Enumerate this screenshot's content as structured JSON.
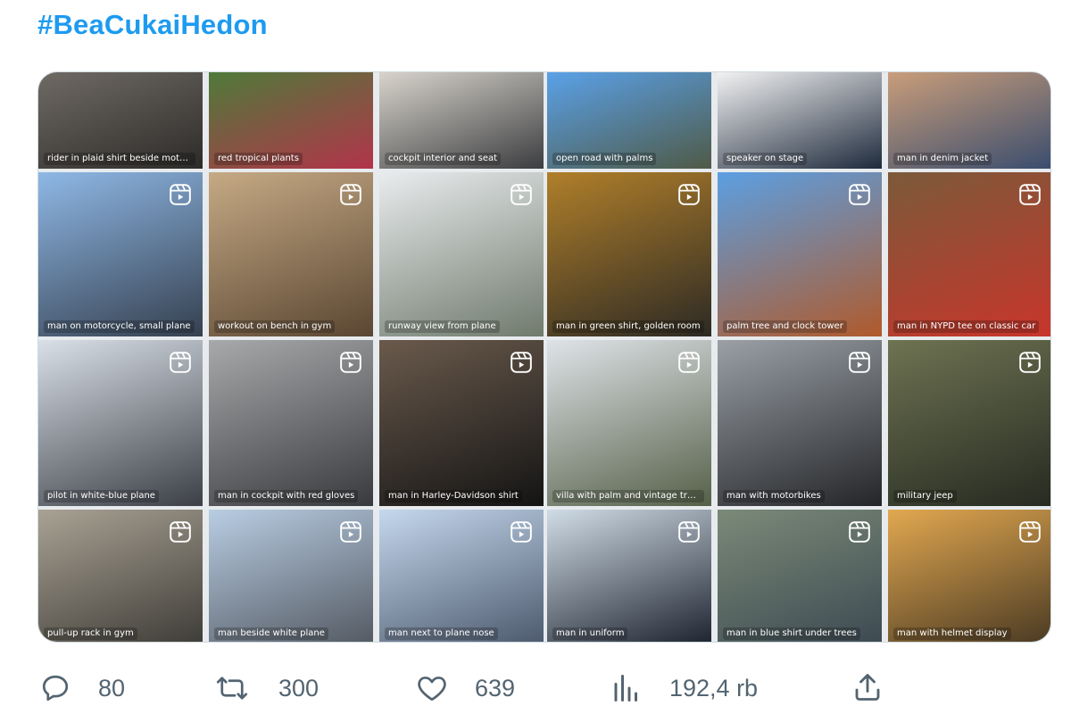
{
  "tweet": {
    "hashtag": "#BeaCukaiHedon"
  },
  "media": {
    "left_grid": [
      {
        "label": "rider in plaid shirt beside motorbike",
        "gradient": [
          "#6f6a64",
          "#2d2b29"
        ],
        "reel": false
      },
      {
        "label": "red tropical plants",
        "gradient": [
          "#4f7a3a",
          "#b2344a"
        ],
        "reel": false
      },
      {
        "label": "cockpit interior and seat",
        "gradient": [
          "#d8d4cc",
          "#3c3d40"
        ],
        "reel": false
      },
      {
        "label": "man on motorcycle, small plane",
        "gradient": [
          "#8fb8e6",
          "#35404f"
        ],
        "reel": true
      },
      {
        "label": "workout on bench in gym",
        "gradient": [
          "#c6aa85",
          "#5a4632"
        ],
        "reel": true
      },
      {
        "label": "runway view from plane",
        "gradient": [
          "#e9ecee",
          "#6f7a6c"
        ],
        "reel": true
      },
      {
        "label": "pilot in white-blue plane",
        "gradient": [
          "#d9e0e8",
          "#3c3f46"
        ],
        "reel": true
      },
      {
        "label": "man in cockpit with red gloves",
        "gradient": [
          "#a7a9ab",
          "#383a3d"
        ],
        "reel": true
      },
      {
        "label": "man in Harley-Davidson shirt",
        "gradient": [
          "#6a5a4c",
          "#141414"
        ],
        "reel": true
      },
      {
        "label": "pull-up rack in gym",
        "gradient": [
          "#a9a294",
          "#3f3d38"
        ],
        "reel": true
      },
      {
        "label": "man beside white plane",
        "gradient": [
          "#b9cde3",
          "#545a63"
        ],
        "reel": true
      },
      {
        "label": "man next to plane nose",
        "gradient": [
          "#c5d8ee",
          "#4d5a6e"
        ],
        "reel": true
      }
    ],
    "right_grid": [
      {
        "label": "open road with palms",
        "gradient": [
          "#5aa1e8",
          "#4f5a47"
        ],
        "reel": false
      },
      {
        "label": "speaker on stage",
        "gradient": [
          "#f2f2f2",
          "#1e2a3c"
        ],
        "reel": false
      },
      {
        "label": "man in denim jacket",
        "gradient": [
          "#c99d7a",
          "#3a4d6e"
        ],
        "reel": false
      },
      {
        "label": "man in green shirt, golden room",
        "gradient": [
          "#b07f2a",
          "#2d2a24"
        ],
        "reel": true
      },
      {
        "label": "palm tree and clock tower",
        "gradient": [
          "#5b9fe2",
          "#b05a2b"
        ],
        "reel": true
      },
      {
        "label": "man in NYPD tee on classic car",
        "gradient": [
          "#7b5a3a",
          "#c8352b"
        ],
        "reel": true
      },
      {
        "label": "villa with palm and vintage truck",
        "gradient": [
          "#dfe3e8",
          "#556048"
        ],
        "reel": true
      },
      {
        "label": "man with motorbikes",
        "gradient": [
          "#9aa0a6",
          "#242528"
        ],
        "reel": true
      },
      {
        "label": "military jeep",
        "gradient": [
          "#6e7352",
          "#262a21"
        ],
        "reel": true
      },
      {
        "label": "man in uniform",
        "gradient": [
          "#d0dce6",
          "#1e2430"
        ],
        "reel": true
      },
      {
        "label": "man in blue shirt under trees",
        "gradient": [
          "#7b8a78",
          "#3d4a52"
        ],
        "reel": true
      },
      {
        "label": "man with helmet display",
        "gradient": [
          "#e2a850",
          "#4a3a23"
        ],
        "reel": true
      }
    ]
  },
  "actions": {
    "replies": "80",
    "retweets": "300",
    "likes": "639",
    "views": "192,4 rb"
  },
  "icons": {
    "reply": "reply-icon",
    "retweet": "retweet-icon",
    "like": "heart-icon",
    "views": "analytics-icon",
    "share": "share-icon",
    "reel": "reels-icon"
  },
  "colors": {
    "accent": "#1d9bf0",
    "icon_gray": "#536471",
    "border": "#cfd9de"
  }
}
